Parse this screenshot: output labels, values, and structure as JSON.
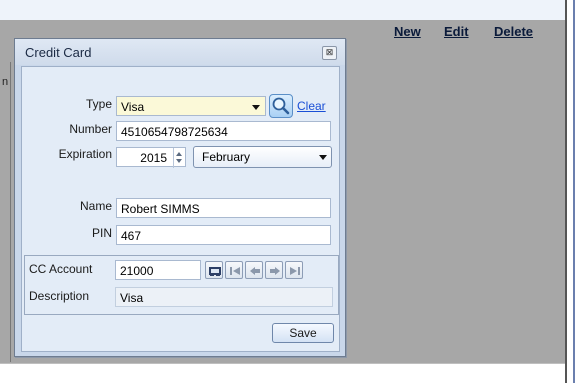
{
  "toolbar": {
    "new_label": "New",
    "edit_label": "Edit",
    "delete_label": "Delete"
  },
  "left_edge": {
    "fragment": "n"
  },
  "dialog": {
    "title": "Credit Card",
    "close_glyph": "⊠"
  },
  "form": {
    "type": {
      "label": "Type",
      "value": "Visa",
      "clear_label": "Clear"
    },
    "number": {
      "label": "Number",
      "value": "4510654798725634"
    },
    "expiration": {
      "label": "Expiration",
      "year": "2015",
      "month": "February"
    },
    "name": {
      "label": "Name",
      "value": "Robert SIMMS"
    },
    "pin": {
      "label": "PIN",
      "value": "467"
    }
  },
  "account": {
    "cc_account_label": "CC Account",
    "cc_account_value": "21000",
    "description_label": "Description",
    "description_value": "Visa"
  },
  "save_label": "Save",
  "colors": {
    "link_blue": "#1a4fd6",
    "dialog_bg": "#c9d7ea",
    "panel_bg": "#e3ecf7",
    "type_field_bg": "#fbf9d8"
  }
}
